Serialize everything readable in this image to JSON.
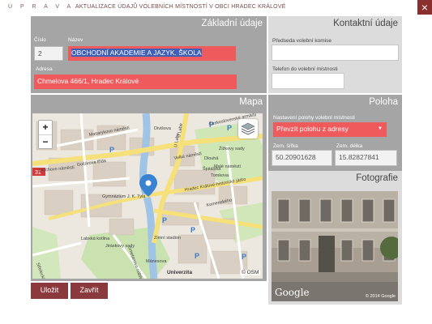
{
  "header": {
    "prefix": "Ú P R A V A",
    "title": "AKTUALIZACE ÚDAJŮ VOLEBNÍCH MÍSTNOSTÍ V OBCI HRADEC KRÁLOVÉ",
    "close_label": "×"
  },
  "basic": {
    "title": "Základní údaje",
    "number_label": "Číslo",
    "number_value": "2",
    "name_label": "Název",
    "name_value": "OBCHODNÍ AKADEMIE A JAZYK. ŠKOLA",
    "address_label": "Adresa",
    "address_value": "Chmelova 466/1, Hradec Králové"
  },
  "contact": {
    "title": "Kontaktní údaje",
    "chair_label": "Předseda volební komise",
    "chair_value": "",
    "phone_label": "Telefon do volební místnosti",
    "phone_value": ""
  },
  "map": {
    "title": "Mapa",
    "zoom_in": "+",
    "zoom_out": "−",
    "attribution": "© OSM",
    "brand": "Univerzita",
    "labels": [
      "Divišova",
      "U Labe",
      "Masarykovo náměstí",
      "Velké náměstí",
      "Žižkovy sady",
      "Ulrichovo náměstí",
      "Gočárova třída",
      "Malé náměstí",
      "Tomkova",
      "Hradec Králové-historické jádro",
      "Gymnázium J. K. Tyla",
      "Komenského",
      "Jiráskovy sady",
      "Labská kotlina",
      "Zimní stadion",
      "Střelecká",
      "Mánesova",
      "Československé armády",
      "Dlouhá",
      "Špitálská",
      "U Labe",
      "Smetanovo nábřeží"
    ],
    "route_label": "31"
  },
  "position": {
    "title": "Poloha",
    "setting_label": "Nastavení polohy volební místnosti",
    "setting_value": "Převzít polohu z adresy",
    "lat_label": "Zem. šířka",
    "lat_value": "50.20901628",
    "lon_label": "Zem. délka",
    "lon_value": "15.82827841"
  },
  "photo": {
    "title": "Fotografie",
    "brand": "Google",
    "copyright": "© 2014 Google"
  },
  "actions": {
    "save_label": "Uložit",
    "close_label": "Zavřít"
  },
  "colors": {
    "accent": "#8a3a3c",
    "highlight": "#ef5a5c",
    "panel": "#a5a5a5"
  }
}
